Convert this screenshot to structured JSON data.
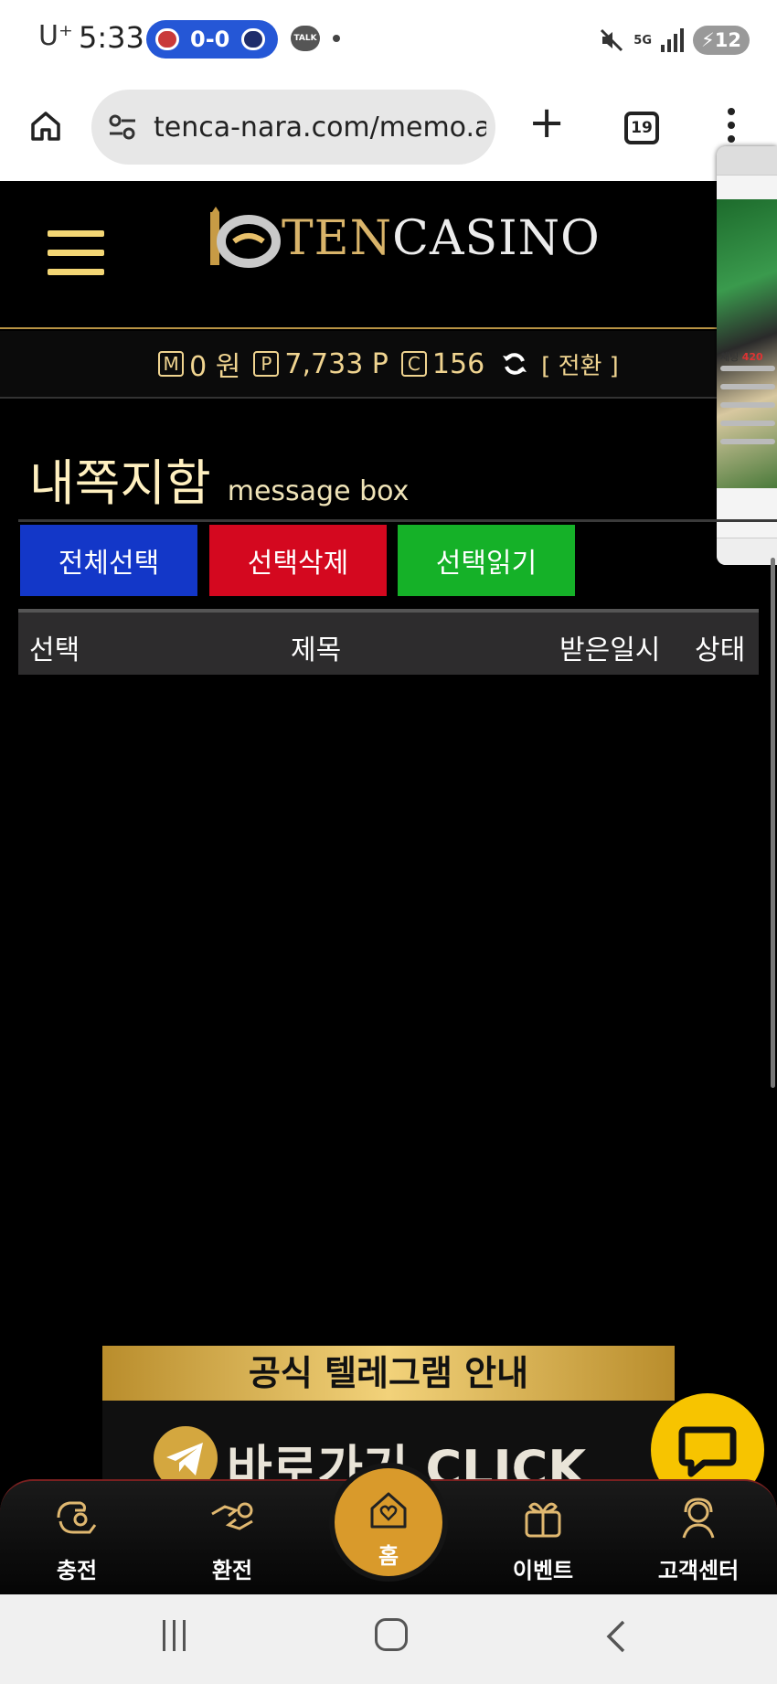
{
  "status_bar": {
    "carrier": "U⁺",
    "time": "5:33",
    "score": "0-0",
    "talk_label": "TALK",
    "network": "5G",
    "battery": "12"
  },
  "browser": {
    "url": "tenca-nara.com/memo.a",
    "tab_count": "19"
  },
  "site": {
    "logo_part1": "TEN",
    "logo_part2": "CASINO"
  },
  "points": {
    "m_icon": "M",
    "money": "0 원",
    "p_icon": "P",
    "point": "7,733 P",
    "c_icon": "C",
    "coin": "156",
    "switch_label": "[ 전환 ]"
  },
  "overlay": {
    "chat_label": "채팅",
    "chat_count": "420"
  },
  "page": {
    "title_ko": "내쪽지함",
    "title_en": "message box"
  },
  "actions": {
    "select_all": "전체선택",
    "delete_selected": "선택삭제",
    "read_selected": "선택읽기"
  },
  "table": {
    "columns": [
      "선택",
      "제목",
      "받은일시",
      "상태"
    ],
    "rows": []
  },
  "banner": {
    "title": "공식 텔레그램 안내",
    "cta": "바로가기 CLICK"
  },
  "bottom_nav": {
    "charge": "충전",
    "exchange": "환전",
    "home": "홈",
    "event": "이벤트",
    "support": "고객센터"
  },
  "colors": {
    "gold": "#f0d490",
    "select_all_bg": "#1337c8",
    "delete_bg": "#d4081f",
    "read_bg": "#15b128",
    "chat_fab": "#f7c400",
    "home_bg": "#d99a2b"
  }
}
